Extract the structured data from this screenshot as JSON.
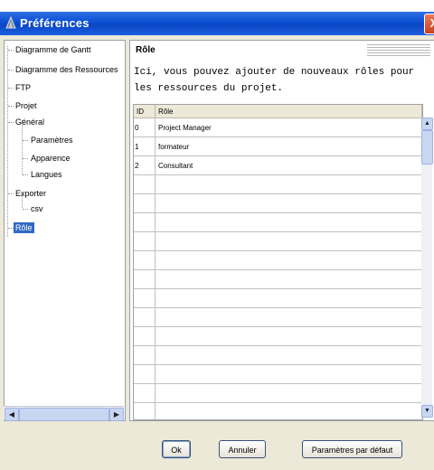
{
  "window": {
    "title": "Préférences",
    "close_glyph": "X"
  },
  "tree": {
    "items": [
      {
        "label": "Diagramme de Gantt"
      },
      {
        "label": "Diagramme des Ressources"
      },
      {
        "label": "FTP"
      },
      {
        "label": "Projet"
      },
      {
        "label": "Général"
      },
      {
        "label": "Paramètres"
      },
      {
        "label": "Apparence"
      },
      {
        "label": "Langues"
      },
      {
        "label": "Exporter"
      },
      {
        "label": "csv"
      },
      {
        "label": "Rôle"
      }
    ],
    "selected": "Rôle"
  },
  "panel": {
    "title": "Rôle",
    "description": "Ici, vous pouvez ajouter de nouveaux rôles pour les ressources du projet."
  },
  "table": {
    "headers": [
      "ID",
      "Rôle"
    ],
    "rows": [
      {
        "id": "0",
        "role": "Project Manager"
      },
      {
        "id": "1",
        "role": "formateur"
      },
      {
        "id": "2",
        "role": "Consultant"
      }
    ]
  },
  "buttons": {
    "ok": "Ok",
    "cancel": "Annuler",
    "defaults": "Paramètres par défaut"
  },
  "icons": {
    "app": "gantt-app-icon",
    "close": "close-icon"
  },
  "colors": {
    "titlebar": "#0b4fd1",
    "selection": "#316ac5",
    "dialog_bg": "#ece9d8"
  }
}
